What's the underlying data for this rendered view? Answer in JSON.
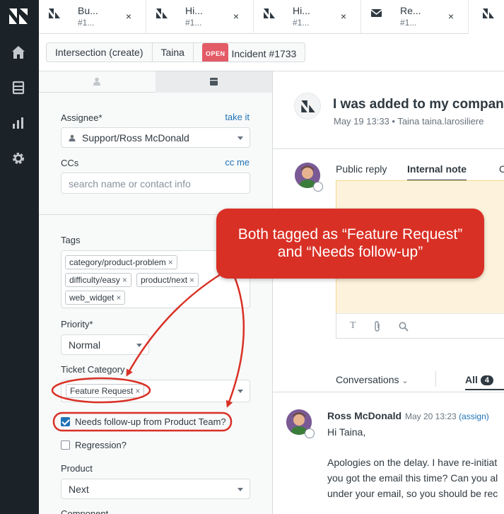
{
  "tabs": [
    {
      "title": "Bu...",
      "sub": "#1...",
      "icon": "zendesk-ticket-icon"
    },
    {
      "title": "Hi...",
      "sub": "#1...",
      "icon": "zendesk-ticket-icon"
    },
    {
      "title": "Hi...",
      "sub": "#1...",
      "icon": "zendesk-ticket-icon"
    },
    {
      "title": "Re...",
      "sub": "#1...",
      "icon": "envelope-icon"
    }
  ],
  "tab_close": "×",
  "breadcrumb": {
    "item1": "Intersection (create)",
    "item2": "Taina",
    "status": "OPEN",
    "item3": "Incident #1733"
  },
  "fields": {
    "assignee_label": "Assignee*",
    "take_it": "take it",
    "assignee_value": "Support/Ross McDonald",
    "ccs_label": "CCs",
    "cc_me": "cc me",
    "ccs_placeholder": "search name or contact info",
    "tags_label": "Tags",
    "tags": [
      "category/product-problem",
      "difficulty/easy",
      "product/next",
      "web_widget"
    ],
    "priority_label": "Priority*",
    "priority_value": "Normal",
    "category_label": "Ticket Category",
    "category_value": "Feature Request",
    "followup_label": "Needs follow-up from Product Team?",
    "followup_checked": true,
    "regression_label": "Regression?",
    "regression_checked": false,
    "product_label": "Product",
    "product_value": "Next",
    "component_label": "Component"
  },
  "ticket": {
    "subject": "I was added to my company",
    "meta": "May 19 13:33 • Taina   taina.larosiliere"
  },
  "reply": {
    "public_tab": "Public reply",
    "internal_tab": "Internal note",
    "third_tab": "C",
    "tools": [
      "T",
      "attachment-icon",
      "search-icon"
    ]
  },
  "conversation": {
    "filter_label": "Conversations",
    "all_label": "All",
    "all_count": "4",
    "author": "Ross McDonald",
    "time": "May 20 13:23",
    "assign": "(assign)",
    "lines": [
      "Hi Taina,",
      "",
      "Apologies on the delay. I have re-initiat",
      "you got the email this time? Can you al",
      "under your email, so you should be rec"
    ]
  },
  "annotation": {
    "line1": "Both tagged as “Feature Request”",
    "line2": "and “Needs follow-up”",
    "color": "#d93025"
  }
}
